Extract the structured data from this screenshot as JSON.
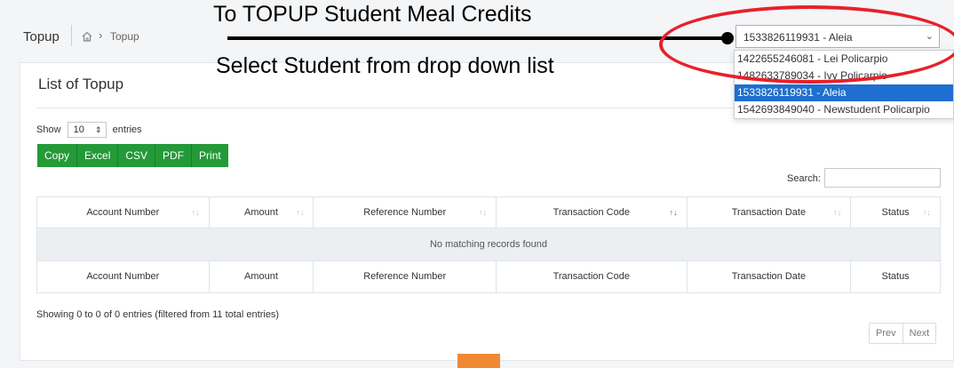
{
  "breadcrumb": {
    "title": "Topup",
    "home_icon": "home-icon",
    "current": "Topup"
  },
  "annotations": {
    "line1": "To TOPUP Student Meal Credits",
    "line2": "Select Student from drop down list",
    "highlight_color": "#e8202a"
  },
  "student_select": {
    "value": "1533826119931 - Aleia",
    "options": [
      "1422655246081 - Lei Policarpio",
      "1482633789034 - Ivy Policarpio",
      "1533826119931 - Aleia",
      "1542693849040 - Newstudent Policarpio"
    ],
    "selected_index": 2
  },
  "card": {
    "title": "List of Topup"
  },
  "length_menu": {
    "show": "Show",
    "value": "10",
    "entries": "entries"
  },
  "buttons": [
    "Copy",
    "Excel",
    "CSV",
    "PDF",
    "Print"
  ],
  "search": {
    "label": "Search:",
    "value": ""
  },
  "table": {
    "columns": [
      "Account Number",
      "Amount",
      "Reference Number",
      "Transaction Code",
      "Transaction Date",
      "Status"
    ],
    "empty_message": "No matching records found"
  },
  "info": "Showing 0 to 0 of 0 entries (filtered from 11 total entries)",
  "pagination": {
    "prev": "Prev",
    "next": "Next"
  },
  "colors": {
    "button_green": "#239a37",
    "selected_option": "#1e6fd0",
    "arrow_orange": "#ef8a32"
  }
}
